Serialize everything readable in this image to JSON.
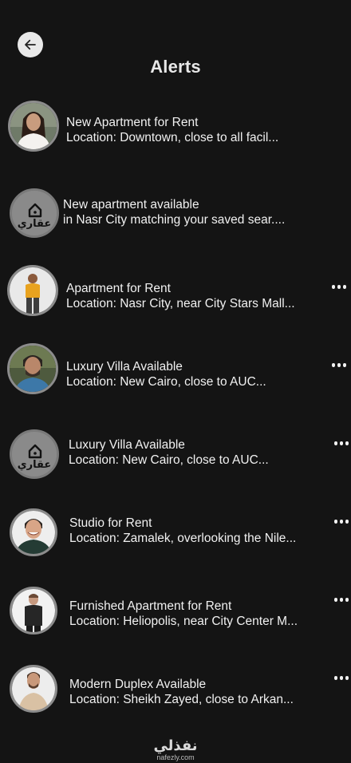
{
  "header": {
    "title": "Alerts",
    "back_icon": "arrow-left-icon"
  },
  "alerts": [
    {
      "title": "New Apartment for Rent",
      "subtitle": "Location: Downtown, close to all facil...",
      "avatar": "woman-portrait",
      "has_menu": false
    },
    {
      "title": "New apartment available",
      "subtitle": "in Nasr City matching your saved sear....",
      "avatar": "aqari-logo",
      "logo_text": "عقاري",
      "has_menu": false
    },
    {
      "title": "Apartment for Rent",
      "subtitle": "Location: Nasr City, near City Stars Mall...",
      "avatar": "man-orange-shirt",
      "has_menu": true
    },
    {
      "title": "Luxury Villa Available",
      "subtitle": "Location: New Cairo, close to AUC...",
      "avatar": "man-beard",
      "has_menu": true
    },
    {
      "title": "Luxury Villa Available",
      "subtitle": "Location: New Cairo, close to AUC...",
      "avatar": "aqari-logo",
      "logo_text": "عقاري",
      "has_menu": true
    },
    {
      "title": "Studio for Rent",
      "subtitle": "Location: Zamalek, overlooking the Nile...",
      "avatar": "man-smiling",
      "has_menu": true
    },
    {
      "title": "Furnished Apartment for Rent",
      "subtitle": "Location: Heliopolis, near City Center M...",
      "avatar": "man-black-sweater",
      "has_menu": true
    },
    {
      "title": "Modern Duplex Available",
      "subtitle": "Location: Sheikh Zayed, close to Arkan...",
      "avatar": "man-beige-sweater",
      "has_menu": true
    }
  ],
  "watermark": {
    "arabic": "نفذلي",
    "latin": "nafezly.com"
  },
  "colors": {
    "background": "#141414",
    "text": "#f1f1f1",
    "avatar_border": "#8c8c8c",
    "back_button": "#e9e9e9"
  }
}
